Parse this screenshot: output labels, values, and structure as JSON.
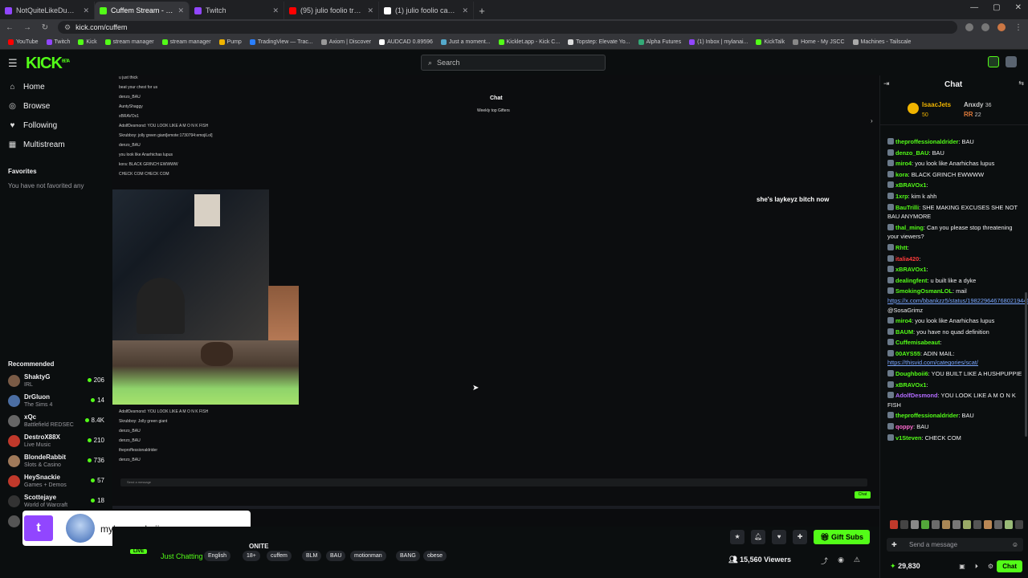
{
  "browser": {
    "tabs": [
      {
        "title": "NotQuiteLikeDuB - Twitch",
        "color": "#9146ff"
      },
      {
        "title": "Cuffem Stream - Watch Live",
        "color": "#53fc18"
      },
      {
        "title": "Twitch",
        "color": "#9146ff"
      },
      {
        "title": "(95) julio foolio trail update",
        "color": "#ff0000"
      },
      {
        "title": "(1) julio foolio case day 6 - Se",
        "color": "#ffffff"
      }
    ],
    "url": "kick.com/cuffem",
    "bookmarks": [
      "YouTube",
      "Twitch",
      "Kick",
      "stream manager",
      "stream manager",
      "Pump",
      "TradingView — Trac...",
      "Axiom | Discover",
      "AUDCAD 0.89596",
      "Just a moment...",
      "Kicklet.app - Kick C...",
      "Topstep: Elevate Yo...",
      "Alpha Futures",
      "(1) Inbox | mylanai...",
      "KickTalk",
      "Home - My JSCC",
      "Machines - Tailscale"
    ]
  },
  "header": {
    "logo": "KICK",
    "logo_sup": "BETA",
    "search_placeholder": "Search"
  },
  "sidebar": {
    "nav": [
      {
        "label": "Home",
        "icon": "home-icon",
        "glyph": "⌂"
      },
      {
        "label": "Browse",
        "icon": "browse-icon",
        "glyph": "◎"
      },
      {
        "label": "Following",
        "icon": "heart-icon",
        "glyph": "♥"
      },
      {
        "label": "Multistream",
        "icon": "grid-icon",
        "glyph": "▦"
      }
    ],
    "favorites_title": "Favorites",
    "favorites_empty": "You have not favorited any",
    "recommended_title": "Recommended",
    "recommended": [
      {
        "name": "ShaktyG",
        "category": "IRL",
        "viewers": "206",
        "color": "#7a5b46"
      },
      {
        "name": "DrGluon",
        "category": "The Sims 4",
        "viewers": "14",
        "color": "#4b6ea3"
      },
      {
        "name": "xQc",
        "category": "Battlefield REDSEC",
        "viewers": "8.4K",
        "color": "#666666"
      },
      {
        "name": "DestroX88X",
        "category": "Live Music",
        "viewers": "210",
        "color": "#c0392b"
      },
      {
        "name": "BlondeRabbit",
        "category": "Slots & Casino",
        "viewers": "736",
        "color": "#a07a5a"
      },
      {
        "name": "HeySnackie",
        "category": "Games + Demos",
        "viewers": "57",
        "color": "#c0392b"
      },
      {
        "name": "Scottejaye",
        "category": "World of Warcraft",
        "viewers": "18",
        "color": "#333333"
      },
      {
        "name": "NoExpertBut",
        "category": "Megabonk",
        "viewers": "74",
        "color": "#555555"
      }
    ]
  },
  "video": {
    "inner_chat_title": "Chat",
    "inner_chat_sub": "Weekly top Gifters",
    "caption": "she's laykeyz bitch now",
    "inner_lines": [
      "u just thick",
      "beat your chest for us",
      "denzo_BAU",
      "AuntyShaggy",
      "xBRAVOx1",
      "AdolfDesmond: YOU LOOK LIKE A M O N K FISH",
      "Skrubboy: jolly green giant[emote:1730794:emojiLol]",
      "denzo_BAU",
      "you look like Anarhichas lupus",
      "kora: BLACK GRINCH EWWWW",
      "CHECK COM CHECK COM"
    ],
    "lower_lines": [
      "AdolfDesmond: YOU LOOK LIKE A M O N K FISH",
      "Skrubboy: Jolly green giant",
      "denzo_BAU",
      "denzo_BAU",
      "theproffessionaldrider",
      "denzo_BAU"
    ],
    "input_placeholder": "Send a message",
    "chat_button": "Chat"
  },
  "twitch_overlay": {
    "logo": "t",
    "username": "mylannmakaii"
  },
  "stream_info": {
    "live": "LIVE",
    "title": "ONITE",
    "category": "Just Chatting",
    "tags": [
      "English",
      "18+",
      "cuffem",
      "BLM",
      "BAU",
      "motionman",
      "BANG",
      "obese"
    ],
    "gift_label": "Gift Subs",
    "viewers": "15,560 Viewers"
  },
  "chat": {
    "title": "Chat",
    "gifters": [
      {
        "name": "IsaacJets",
        "count": "50"
      },
      {
        "name": "Anxdy",
        "count": "36"
      },
      {
        "name": "RR",
        "count": "22"
      }
    ],
    "messages": [
      {
        "user": "theproffessionaldrider",
        "text": "BAU",
        "color": "#53fc18"
      },
      {
        "user": "denzo_BAU",
        "text": "BAU",
        "color": "#53fc18"
      },
      {
        "user": "miro4",
        "text": "you look like Anarhichas lupus",
        "color": "#53fc18"
      },
      {
        "user": "kora",
        "text": "BLACK GRINCH EWWWW",
        "color": "#53fc18"
      },
      {
        "user": "xBRAVOx1",
        "text": "",
        "color": "#53fc18"
      },
      {
        "user": "1xrp",
        "text": "kim k ahh",
        "color": "#53fc18"
      },
      {
        "user": "BauTrilli",
        "text": "SHE MAKING EXCUSES SHE NOT BAU ANYMORE",
        "color": "#53fc18"
      },
      {
        "user": "thal_ming",
        "text": "Can you please stop threatening your viewers?",
        "color": "#53fc18"
      },
      {
        "user": "Rhtt",
        "text": "",
        "color": "#53fc18"
      },
      {
        "user": "italia420",
        "text": "",
        "color": "#ff3b3b"
      },
      {
        "user": "xBRAVOx1",
        "text": "",
        "color": "#53fc18"
      },
      {
        "user": "dealingfent",
        "text": "u built like a dyke",
        "color": "#53fc18"
      },
      {
        "user": "SmokingOsmanLOL",
        "text": "mail",
        "link": "https://x.com/bbankzz5/status/19822964676802194402",
        "tail": "@SosaGrimz",
        "color": "#53fc18"
      },
      {
        "user": "miro4",
        "text": "you look like Anarhichas lupus",
        "color": "#53fc18"
      },
      {
        "user": "BAUM",
        "text": "you have no quad definition",
        "color": "#53fc18"
      },
      {
        "user": "Cuffemisabeaut",
        "text": "",
        "color": "#53fc18"
      },
      {
        "user": "00AYS55",
        "text": "ADIN MAIL:",
        "link": "https://thisvid.com/categories/scat/",
        "color": "#53fc18"
      },
      {
        "user": "Doughboii6",
        "text": "YOU BUILT LIKE A HUSHPUPPIE",
        "color": "#53fc18"
      },
      {
        "user": "xBRAVOx1",
        "text": "",
        "color": "#53fc18"
      },
      {
        "user": "AdolfDesmond",
        "text": "YOU LOOK LIKE A M O N K FISH",
        "color": "#b36bff"
      },
      {
        "user": "theproffessionaldrider",
        "text": "BAU",
        "color": "#53fc18"
      },
      {
        "user": "qoppy",
        "text": "BAU",
        "color": "#ff6bd0"
      },
      {
        "user": "v1Steven",
        "text": "CHECK COM",
        "color": "#53fc18"
      }
    ],
    "input_placeholder": "Send a message",
    "points": "29,830",
    "send_label": "Chat"
  }
}
